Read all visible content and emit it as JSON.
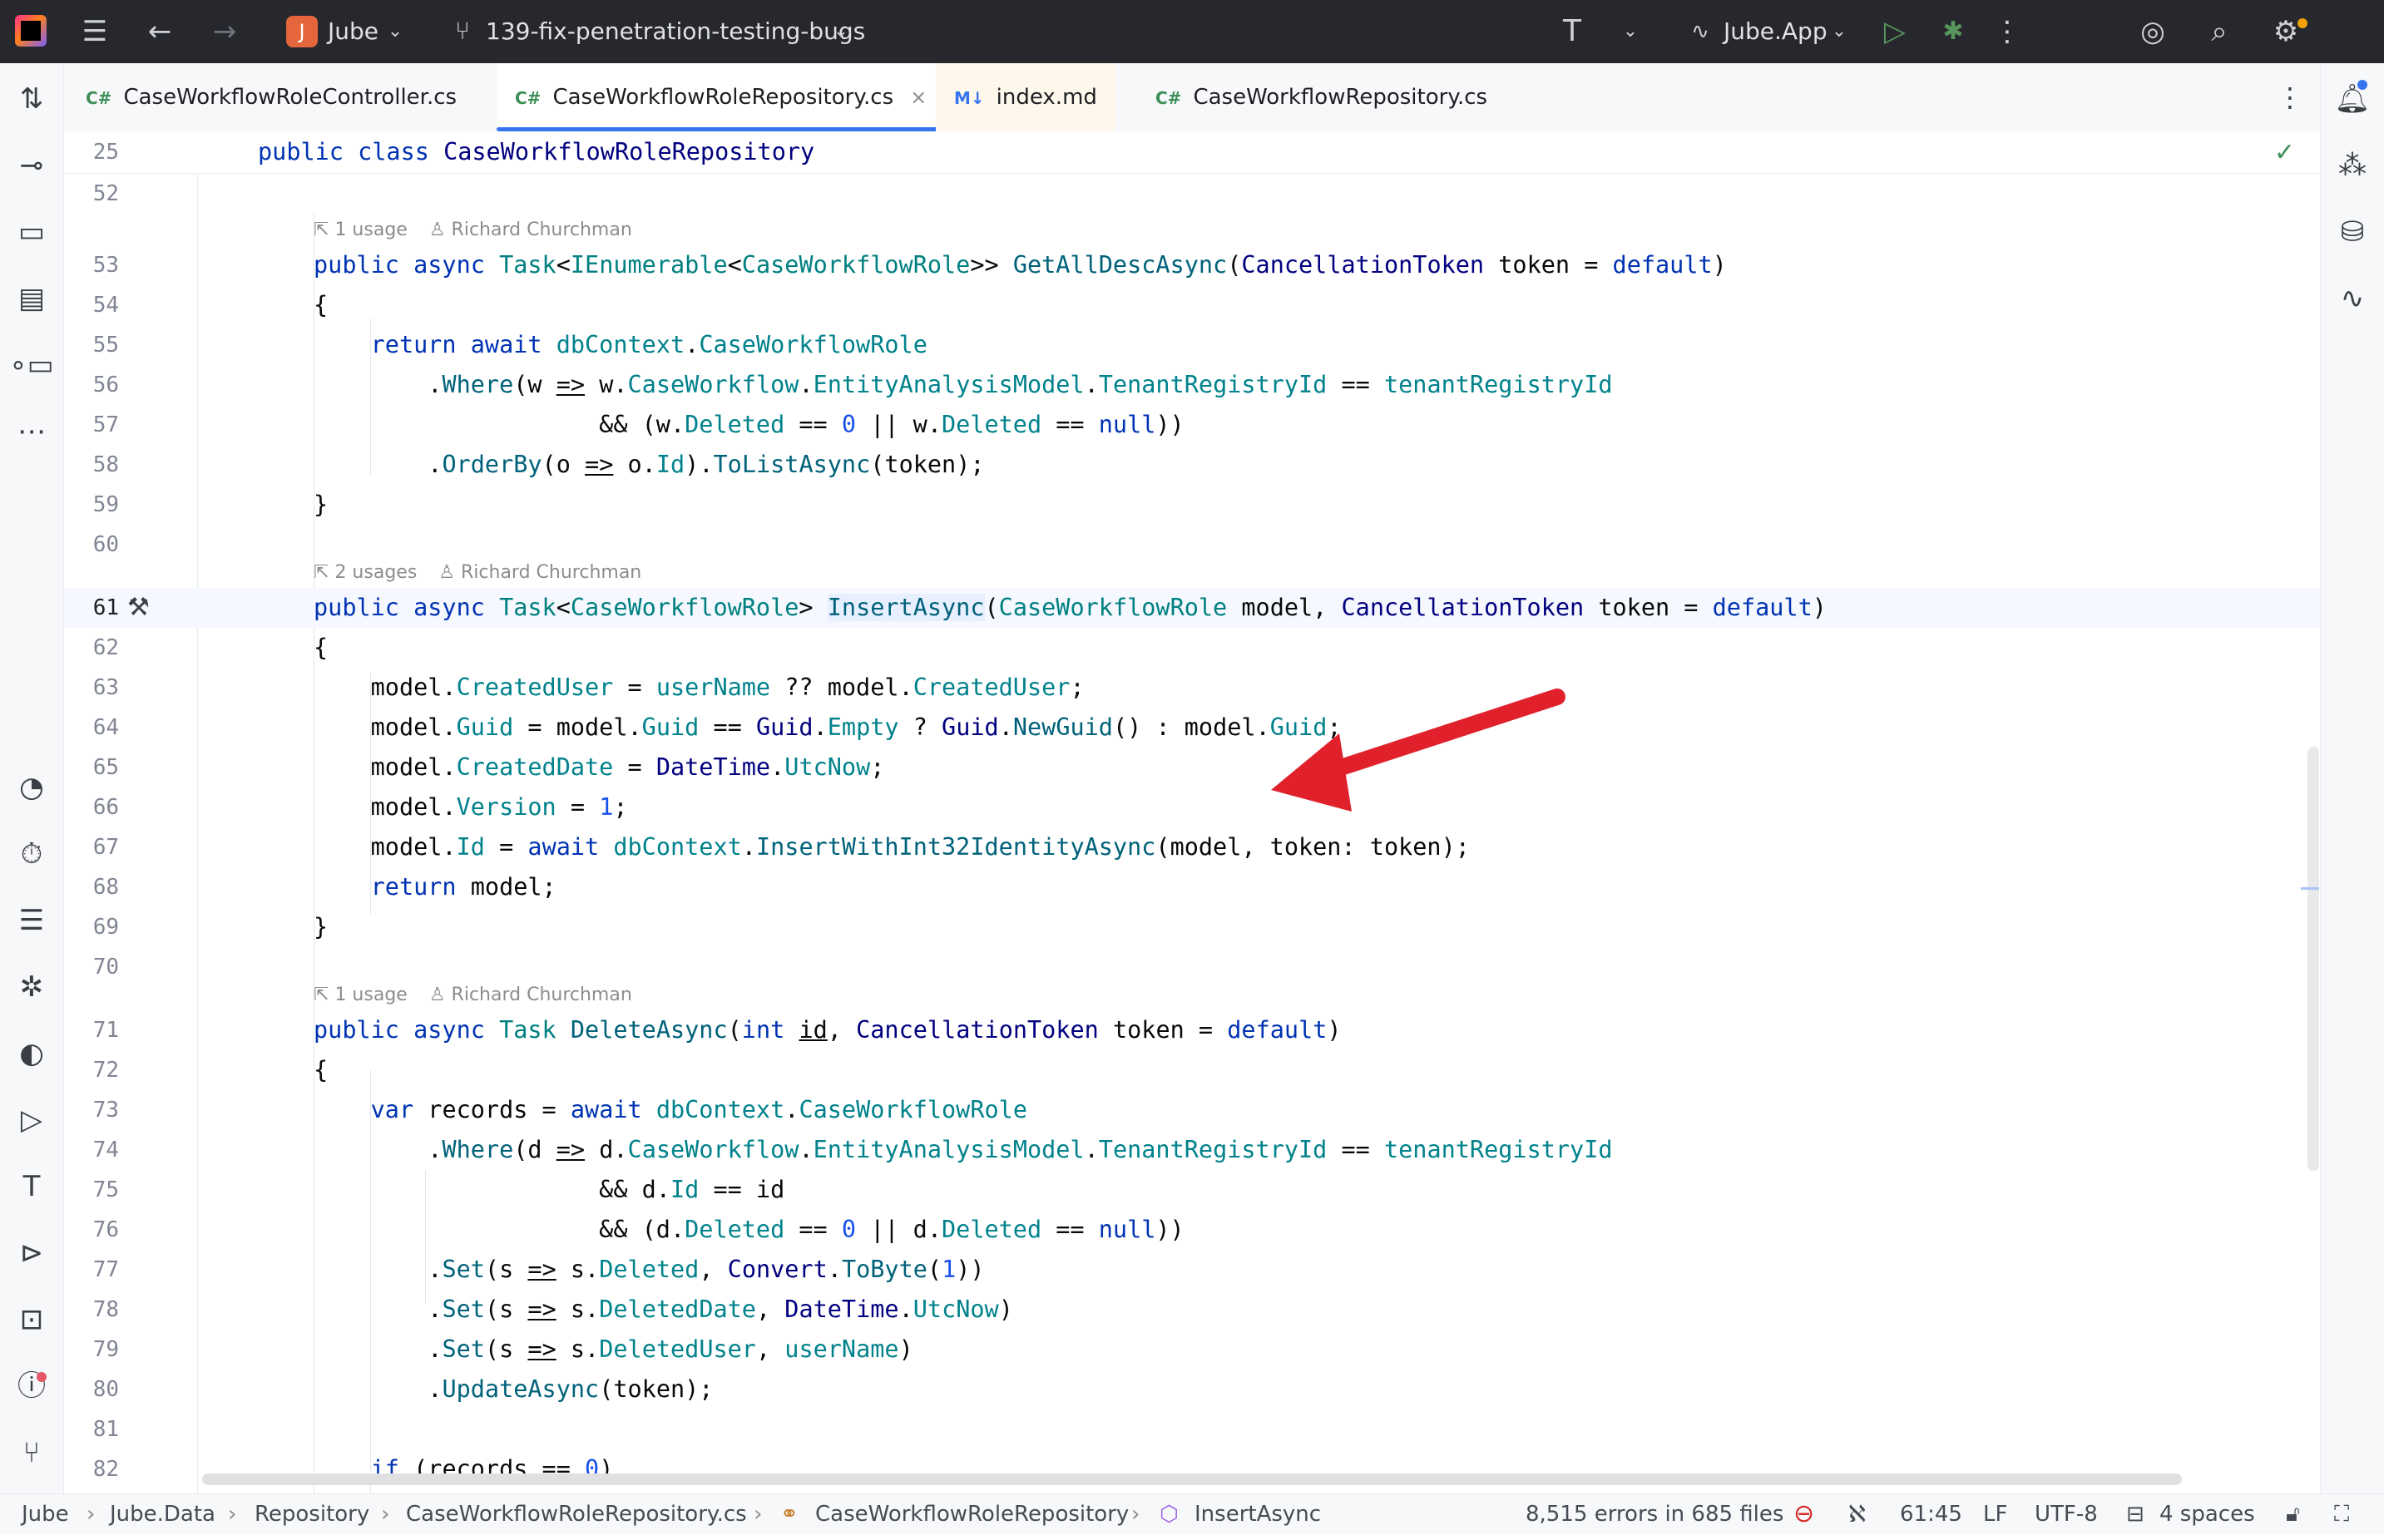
{
  "titlebar": {
    "project_initial": "J",
    "project_name": "Jube",
    "branch": "139-fix-penetration-testing-bugs",
    "run_config": "Jube.App"
  },
  "tabs": [
    {
      "lang": "C#",
      "label": "CaseWorkflowRoleController.cs",
      "active": false
    },
    {
      "lang": "C#",
      "label": "CaseWorkflowRoleRepository.cs",
      "active": true,
      "close": "×"
    },
    {
      "lang": "M↓",
      "label": "index.md",
      "active": false
    },
    {
      "lang": "C#",
      "label": "CaseWorkflowRepository.cs",
      "active": false
    }
  ],
  "sticky": {
    "line": "25",
    "code": "public class CaseWorkflowRoleRepository"
  },
  "hints": {
    "h1_usage": "1 usage",
    "h1_author": "Richard Churchman",
    "h2_usage": "2 usages",
    "h2_author": "Richard Churchman",
    "h3_usage": "1 usage",
    "h3_author": "Richard Churchman"
  },
  "line_numbers": [
    "52",
    "53",
    "54",
    "55",
    "56",
    "57",
    "58",
    "59",
    "60",
    "61",
    "62",
    "63",
    "64",
    "65",
    "66",
    "67",
    "68",
    "69",
    "70",
    "71",
    "72",
    "73",
    "74",
    "75",
    "76",
    "77",
    "78",
    "79",
    "80",
    "81",
    "82"
  ],
  "statusbar": {
    "crumb_1": "Jube",
    "crumb_2": "Jube.Data",
    "crumb_3": "Repository",
    "crumb_4": "CaseWorkflowRoleRepository.cs",
    "crumb_5": "CaseWorkflowRoleRepository",
    "crumb_6": "InsertAsync",
    "errors": "8,515 errors in 685 files",
    "position": "61:45",
    "line_sep": "LF",
    "encoding": "UTF-8",
    "indent": "4 spaces"
  },
  "colors": {
    "accent": "#3574f0",
    "annotation_arrow": "#e0212b",
    "titlebar": "#27282e"
  }
}
